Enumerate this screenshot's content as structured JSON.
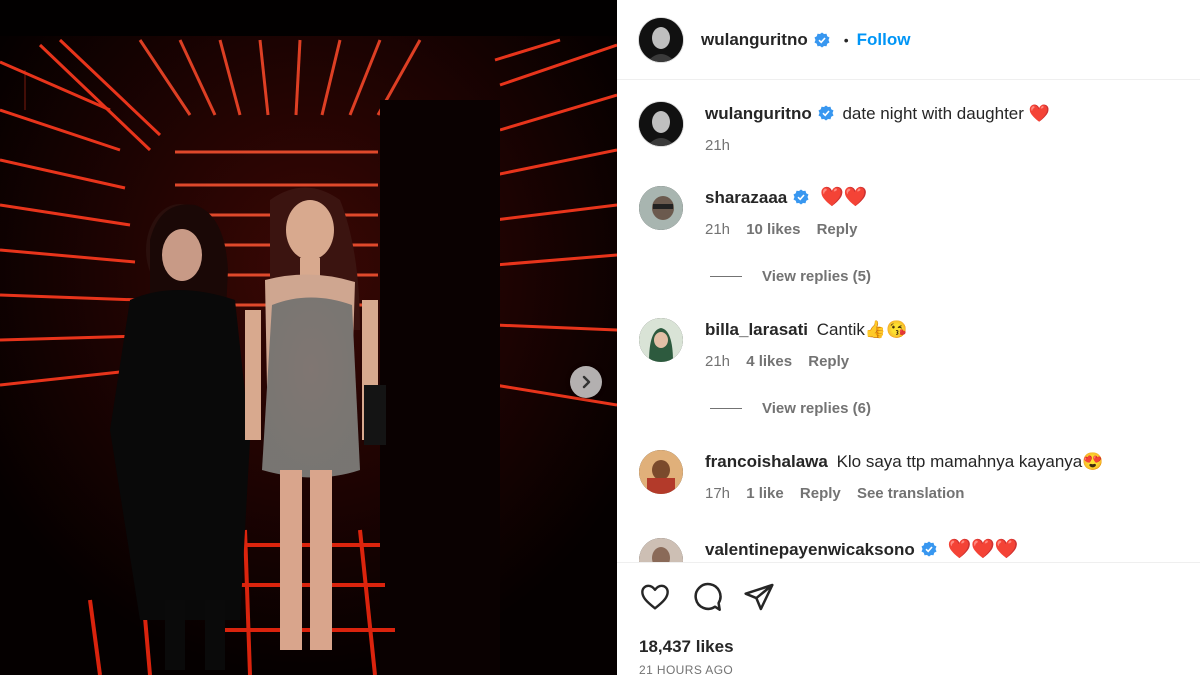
{
  "post": {
    "author": "wulanguritno",
    "follow_label": "Follow",
    "separator": "•",
    "caption": "date night with daughter ❤️",
    "caption_time": "21h",
    "likes": "18,437 likes",
    "posted_ago": "21 HOURS AGO"
  },
  "comments": [
    {
      "username": "sharazaaa",
      "verified": true,
      "text": "❤️❤️",
      "time": "21h",
      "likes": "10 likes",
      "reply_label": "Reply",
      "view_replies": "View replies (5)"
    },
    {
      "username": "billa_larasati",
      "verified": false,
      "text": "Cantik👍😘",
      "time": "21h",
      "likes": "4 likes",
      "reply_label": "Reply",
      "view_replies": "View replies (6)"
    },
    {
      "username": "francoishalawa",
      "verified": false,
      "text": "Klo saya ttp mamahnya kayanya😍",
      "time": "17h",
      "likes": "1 like",
      "reply_label": "Reply",
      "translation_label": "See translation"
    },
    {
      "username": "valentinepayenwicaksono",
      "verified": true,
      "text": "❤️❤️❤️"
    }
  ],
  "icons": {
    "like": "heart-icon",
    "comment": "comment-icon",
    "share": "share-icon",
    "next": "chevron-right-icon",
    "verified": "verified-badge-icon"
  },
  "colors": {
    "accent": "#0095f6",
    "verified": "#3897f0",
    "neon": "#ff2a1a"
  }
}
